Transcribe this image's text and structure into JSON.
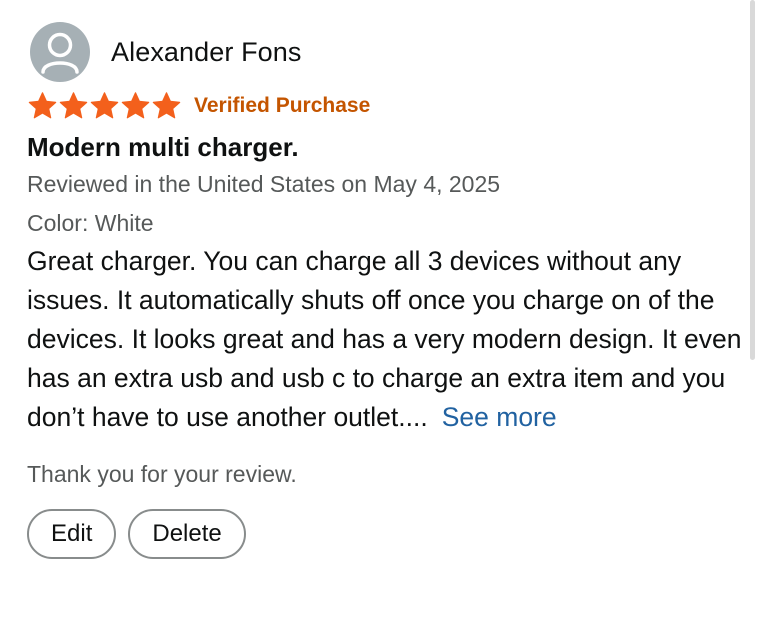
{
  "review": {
    "reviewer_name": "Alexander Fons",
    "rating": 5,
    "rating_max": 5,
    "star_color": "#f3601c",
    "verified_label": "Verified Purchase",
    "title": "Modern multi charger.",
    "date_line": "Reviewed in the United States on May 4, 2025",
    "color_line": "Color: White",
    "body": "Great charger. You can charge all 3 devices without any issues. It automatically shuts off once you charge on of the devices. It looks great and has a very modern design. It even has an extra usb and usb c to charge an extra item and you don’t have to use another outlet....",
    "see_more_label": "See more",
    "thanks_text": "Thank you for your review.",
    "edit_label": "Edit",
    "delete_label": "Delete"
  },
  "icons": {
    "avatar": "user-avatar-icon",
    "star": "star-icon"
  },
  "colors": {
    "verified": "#c45500",
    "link": "#2162a1",
    "secondary_text": "#565959",
    "primary_text": "#0f1111"
  }
}
